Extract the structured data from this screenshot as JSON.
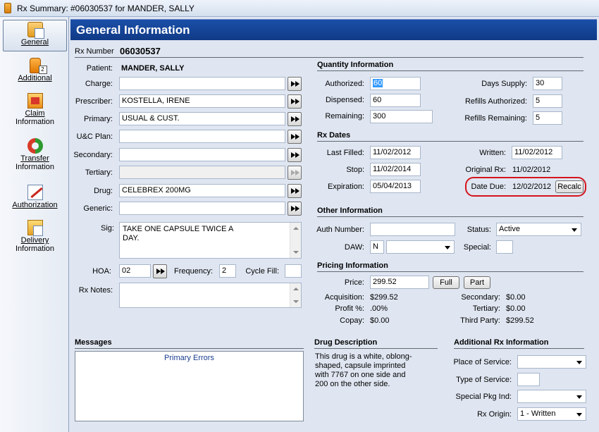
{
  "window": {
    "title": "Rx Summary: #06030537 for MANDER, SALLY"
  },
  "nav": {
    "items": [
      {
        "label": "General",
        "icon": "general-icon"
      },
      {
        "label": "Additional",
        "icon": "additional-icon"
      },
      {
        "label": "Claim",
        "label2": "Information",
        "icon": "claim-icon"
      },
      {
        "label": "Transfer",
        "label2": "Information",
        "icon": "transfer-icon"
      },
      {
        "label": "Authorization",
        "icon": "authorization-icon"
      },
      {
        "label": "Delivery",
        "label2": "Information",
        "icon": "delivery-icon"
      }
    ]
  },
  "header": {
    "title": "General Information"
  },
  "rx": {
    "number_label": "Rx Number",
    "number": "06030537"
  },
  "patient": {
    "patient_label": "Patient:",
    "patient": "MANDER, SALLY",
    "charge_label": "Charge:",
    "charge": "",
    "prescriber_label": "Prescriber:",
    "prescriber": "KOSTELLA, IRENE",
    "primary_label": "Primary:",
    "primary": "USUAL & CUST.",
    "uc_plan_label": "U&C Plan:",
    "uc_plan": "",
    "secondary_label": "Secondary:",
    "secondary": "",
    "tertiary_label": "Tertiary:",
    "tertiary": "",
    "drug_label": "Drug:",
    "drug": "CELEBREX 200MG",
    "generic_label": "Generic:",
    "generic": "",
    "sig_label": "Sig:",
    "sig_line1": "TAKE ONE CAPSULE TWICE A",
    "sig_line2": "DAY.",
    "hoa_label": "HOA:",
    "hoa": "02",
    "frequency_label": "Frequency:",
    "frequency": "2",
    "cycle_fill_label": "Cycle Fill:",
    "cycle_fill": "",
    "rx_notes_label": "Rx Notes:",
    "rx_notes": ""
  },
  "quantity": {
    "title": "Quantity Information",
    "authorized_label": "Authorized:",
    "authorized": "60",
    "dispensed_label": "Dispensed:",
    "dispensed": "60",
    "remaining_label": "Remaining:",
    "remaining": "300",
    "days_supply_label": "Days Supply:",
    "days_supply": "30",
    "refills_authorized_label": "Refills Authorized:",
    "refills_authorized": "5",
    "refills_remaining_label": "Refills Remaining:",
    "refills_remaining": "5"
  },
  "dates": {
    "title": "Rx Dates",
    "last_filled_label": "Last Filled:",
    "last_filled": "11/02/2012",
    "stop_label": "Stop:",
    "stop": "11/02/2014",
    "expiration_label": "Expiration:",
    "expiration": "05/04/2013",
    "written_label": "Written:",
    "written": "11/02/2012",
    "original_rx_label": "Original Rx:",
    "original_rx": "11/02/2012",
    "date_due_label": "Date Due:",
    "date_due": "12/02/2012",
    "recalc_label": "Recalc"
  },
  "other": {
    "title": "Other Information",
    "auth_number_label": "Auth Number:",
    "auth_number": "",
    "daw_label": "DAW:",
    "daw": "N",
    "daw_desc": "",
    "status_label": "Status:",
    "status": "Active",
    "special_label": "Special:",
    "special": ""
  },
  "pricing": {
    "title": "Pricing Information",
    "price_label": "Price:",
    "price": "299.52",
    "full_label": "Full",
    "part_label": "Part",
    "acquisition_label": "Acquisition:",
    "acquisition": "$299.52",
    "profit_label": "Profit %:",
    "profit": ".00%",
    "copay_label": "Copay:",
    "copay": "$0.00",
    "secondary_label": "Secondary:",
    "secondary": "$0.00",
    "tertiary_label": "Tertiary:",
    "tertiary": "$0.00",
    "third_party_label": "Third Party:",
    "third_party": "$299.52"
  },
  "messages": {
    "title": "Messages",
    "primary_errors": "Primary Errors"
  },
  "drug_description": {
    "title": "Drug Description",
    "line1": "This drug is a white, oblong-",
    "line2": "shaped, capsule imprinted",
    "line3": "with 7767 on one side and",
    "line4": "200 on the other side."
  },
  "additional_rx": {
    "title": "Additional Rx Information",
    "place_label": "Place of Service:",
    "place": "",
    "type_label": "Type of Service:",
    "type": "",
    "pkg_label": "Special Pkg Ind:",
    "pkg": "",
    "origin_label": "Rx Origin:",
    "origin": "1 - Written"
  },
  "colors": {
    "header_bg": "#1a4fa8",
    "highlight_ring": "#d4141c",
    "selection": "#3399ff"
  }
}
